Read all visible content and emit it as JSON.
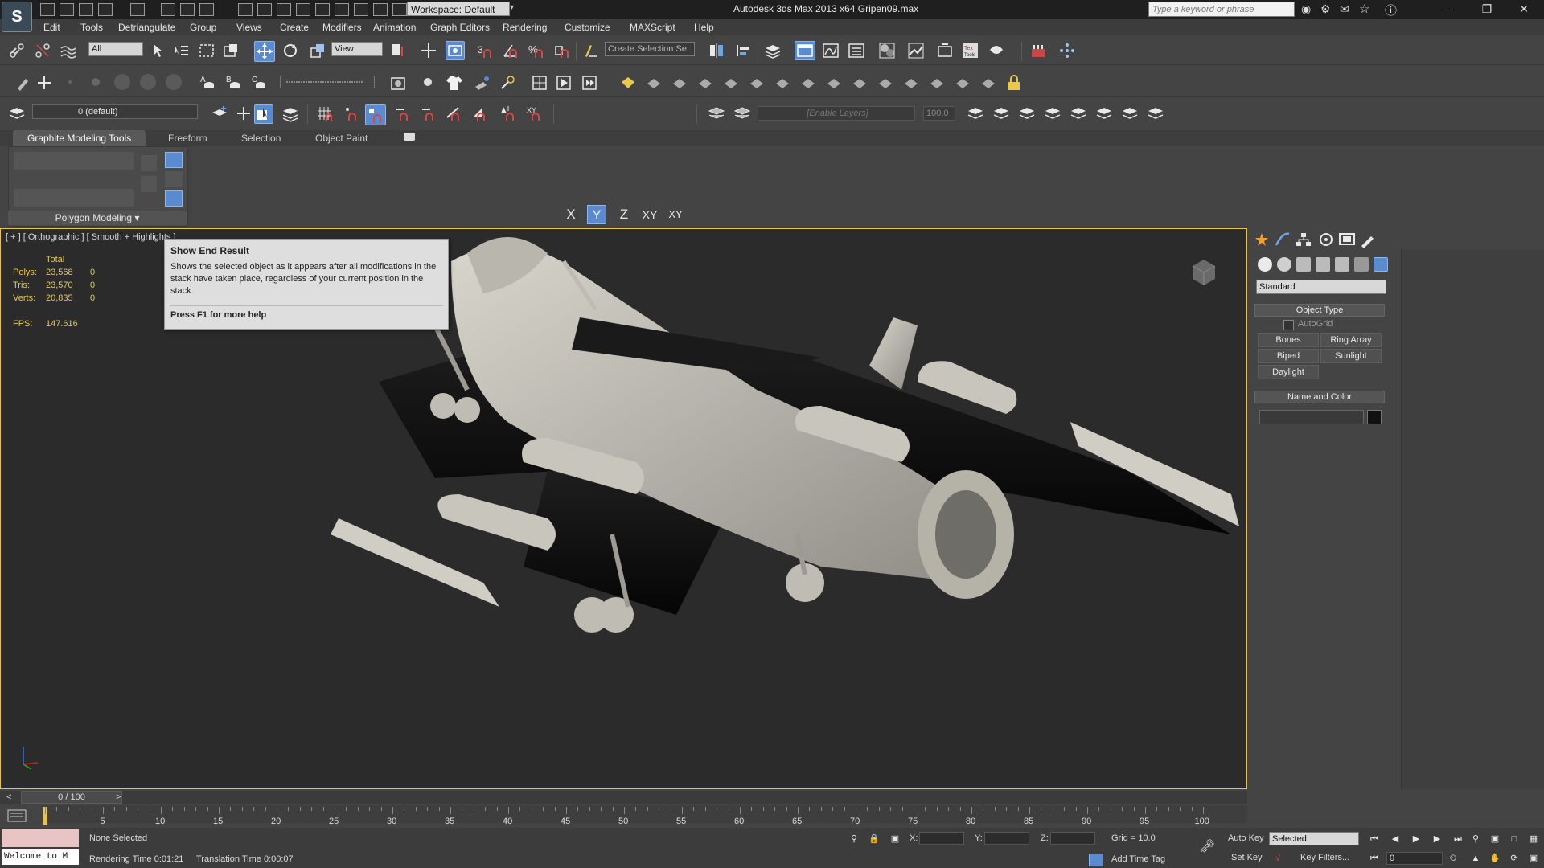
{
  "titlebar": {
    "title": "Autodesk 3ds Max  2013 x64     Gripen09.max",
    "workspace": "Workspace: Default",
    "search_placeholder": "Type a keyword or phrase"
  },
  "menu": [
    "Edit",
    "Tools",
    "Detriangulate",
    "Group",
    "Views",
    "Create",
    "Modifiers",
    "Animation",
    "Graph Editors",
    "Rendering",
    "Customize",
    "MAXScript",
    "Help"
  ],
  "toolbar": {
    "selection_filter": "All",
    "ref_coord": "View",
    "named_selection": "Create Selection Se",
    "layer": "0 (default)",
    "enable_layers": "[Enable Layers]",
    "percent": "100.0",
    "axis_x": "X",
    "axis_y": "Y",
    "axis_z": "Z",
    "axis_xy": "XY",
    "axis_xy2": "XY"
  },
  "ribbon": {
    "tabs": [
      "Graphite Modeling Tools",
      "Freeform",
      "Selection",
      "Object Paint"
    ],
    "panel_label": "Polygon Modeling"
  },
  "viewport": {
    "label": "[ + ] [ Orthographic ] [ Smooth + Highlights ]",
    "stats_header": "Total",
    "polys_label": "Polys:",
    "polys_total": "23,568",
    "polys_sel": "0",
    "tris_label": "Tris:",
    "tris_total": "23,570",
    "tris_sel": "0",
    "verts_label": "Verts:",
    "verts_total": "20,835",
    "verts_sel": "0",
    "fps_label": "FPS:",
    "fps_value": "147.616"
  },
  "tooltip": {
    "title": "Show End Result",
    "body": "Shows the selected object as it appears after all modifications in the stack have taken place, regardless of your current position in the stack.",
    "help": "Press F1 for more help"
  },
  "command_panel": {
    "category": "Standard",
    "object_type_header": "Object Type",
    "autogrid": "AutoGrid",
    "buttons": [
      "Bones",
      "Ring Array",
      "Biped",
      "Sunlight",
      "Daylight"
    ],
    "name_color_header": "Name and Color",
    "swatch_color": "#111111"
  },
  "timeline": {
    "frame_counter": "0 / 100",
    "ticks": [
      "5",
      "10",
      "15",
      "20",
      "25",
      "30",
      "35",
      "40",
      "45",
      "50",
      "55",
      "60",
      "65",
      "70",
      "75",
      "80",
      "85",
      "90",
      "95",
      "100"
    ]
  },
  "status": {
    "listener": "Welcome to M",
    "selection": "None Selected",
    "rendering_time": "Rendering Time  0:01:21",
    "translation_time": "Translation Time  0:00:07",
    "x_label": "X:",
    "y_label": "Y:",
    "z_label": "Z:",
    "grid": "Grid = 10.0",
    "add_time_tag": "Add Time Tag",
    "auto_key": "Auto Key",
    "set_key": "Set Key",
    "selected_dropdown": "Selected",
    "key_filters": "Key Filters...",
    "frame": "0"
  },
  "colors": {
    "accent_blue": "#5a8bd0",
    "viewport_border": "#e4c24c",
    "stats_yellow": "#e8c94e"
  }
}
